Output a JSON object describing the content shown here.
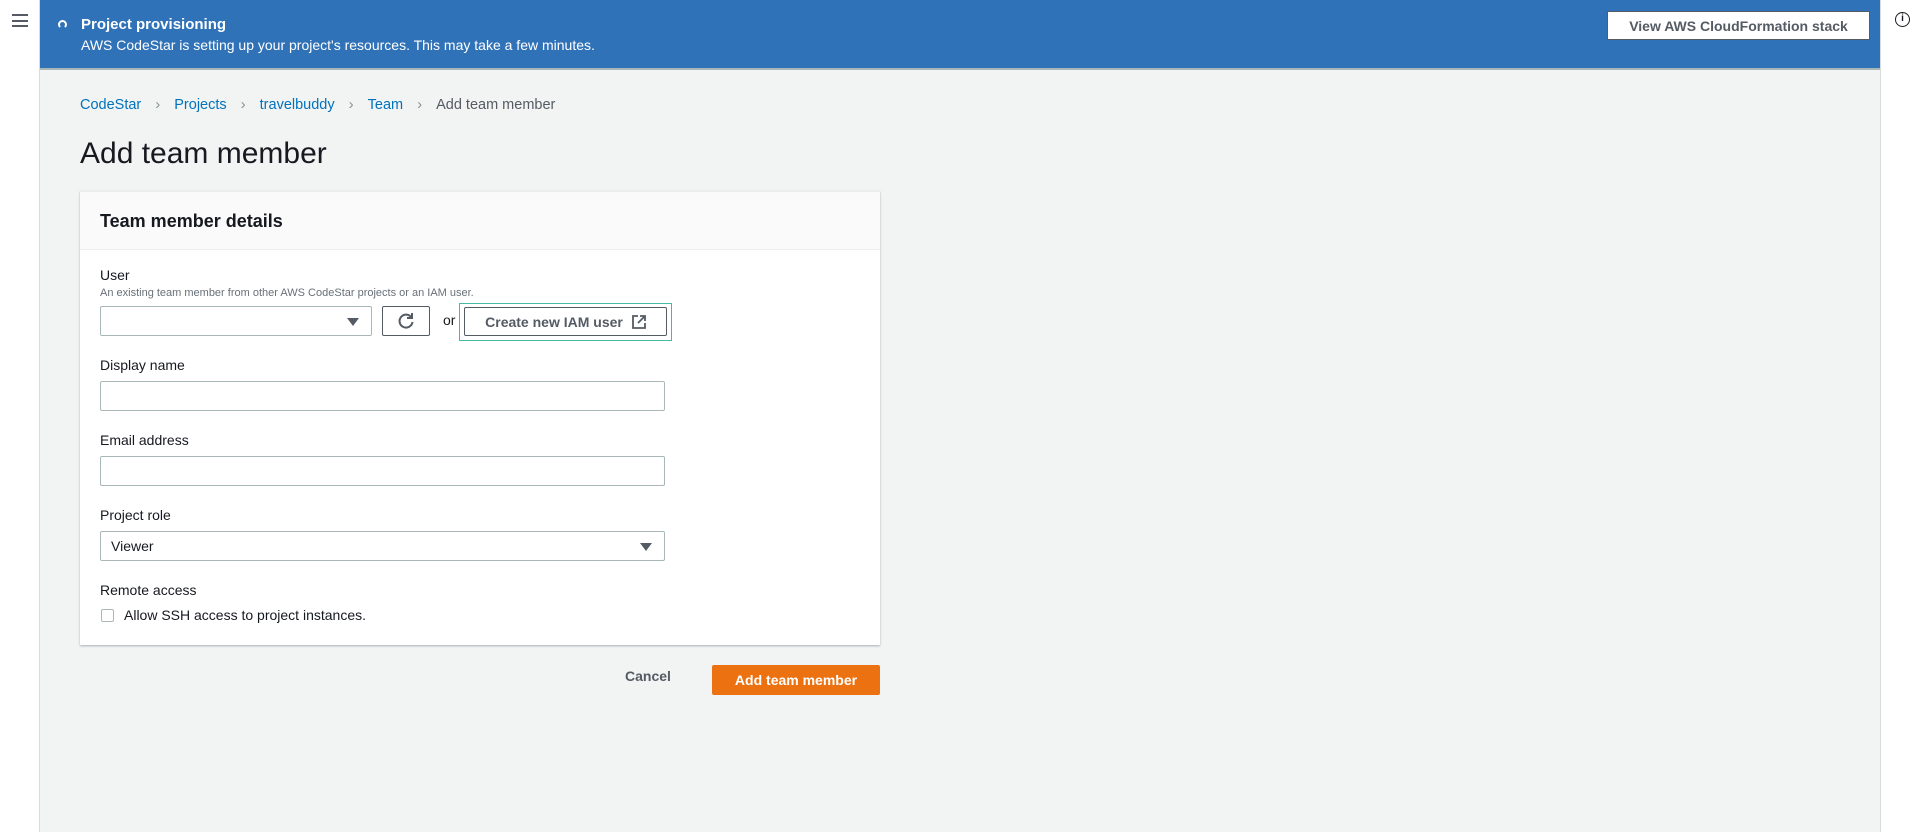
{
  "banner": {
    "title": "Project provisioning",
    "description": "AWS CodeStar is setting up your project's resources. This may take a few minutes.",
    "button": "View AWS CloudFormation stack",
    "color": "#3072b8"
  },
  "breadcrumb": [
    {
      "label": "CodeStar"
    },
    {
      "label": "Projects"
    },
    {
      "label": "travelbuddy"
    },
    {
      "label": "Team"
    },
    {
      "label": "Add team member"
    }
  ],
  "page_title": "Add team member",
  "card": {
    "title": "Team member details",
    "user": {
      "label": "User",
      "description": "An existing team member from other AWS CodeStar projects or an IAM user.",
      "value": "",
      "or": "or",
      "create_button": "Create new IAM user"
    },
    "display_name": {
      "label": "Display name",
      "value": ""
    },
    "email": {
      "label": "Email address",
      "value": ""
    },
    "project_role": {
      "label": "Project role",
      "value": "Viewer"
    },
    "remote_access": {
      "label": "Remote access",
      "checkbox_label": "Allow SSH access to project instances.",
      "checked": false
    }
  },
  "actions": {
    "cancel": "Cancel",
    "submit": "Add team member",
    "accent": "#ec7211"
  }
}
